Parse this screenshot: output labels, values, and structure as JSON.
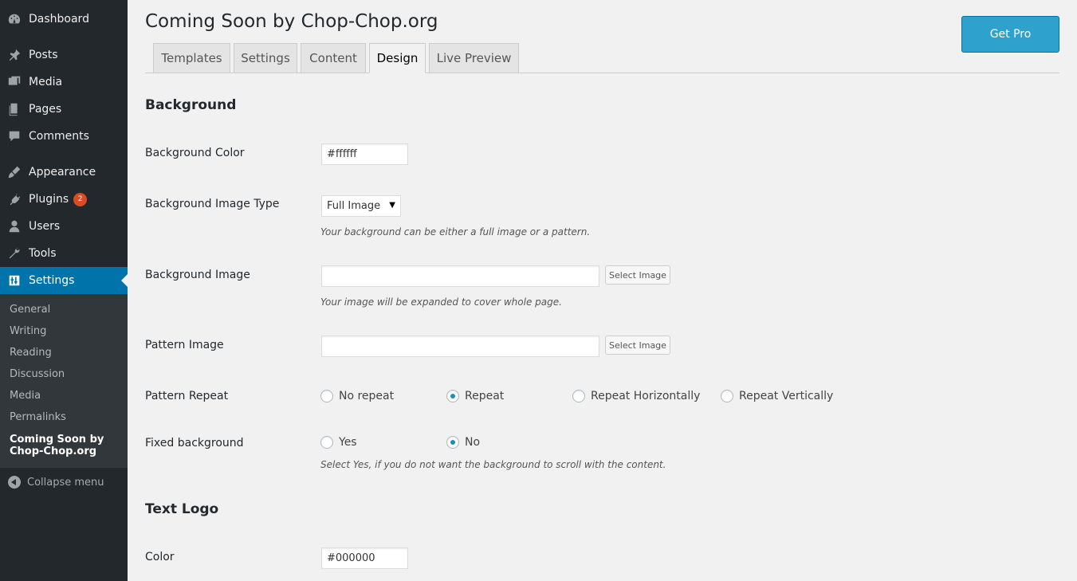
{
  "sidebar": {
    "items": [
      {
        "label": "Dashboard",
        "icon": "dashboard-icon"
      },
      {
        "label": "Posts",
        "icon": "pin-icon"
      },
      {
        "label": "Media",
        "icon": "media-icon"
      },
      {
        "label": "Pages",
        "icon": "pages-icon"
      },
      {
        "label": "Comments",
        "icon": "comment-icon"
      },
      {
        "label": "Appearance",
        "icon": "brush-icon"
      },
      {
        "label": "Plugins",
        "icon": "plug-icon",
        "badge": "2"
      },
      {
        "label": "Users",
        "icon": "user-icon"
      },
      {
        "label": "Tools",
        "icon": "wrench-icon"
      },
      {
        "label": "Settings",
        "icon": "settings-icon",
        "active": true
      }
    ],
    "submenu": [
      "General",
      "Writing",
      "Reading",
      "Discussion",
      "Media",
      "Permalinks",
      "Coming Soon by Chop-Chop.org"
    ],
    "collapse_label": "Collapse menu"
  },
  "header": {
    "title": "Coming Soon by Chop-Chop.org",
    "get_pro_label": "Get Pro"
  },
  "tabs": [
    "Templates",
    "Settings",
    "Content",
    "Design",
    "Live Preview"
  ],
  "active_tab": "Design",
  "background_section": {
    "title": "Background",
    "bg_color_label": "Background Color",
    "bg_color_value": "#ffffff",
    "bg_type_label": "Background Image Type",
    "bg_type_value": "Full Image",
    "bg_type_desc": "Your background can be either a full image or a pattern.",
    "bg_image_label": "Background Image",
    "bg_image_value": "",
    "select_image_label": "Select Image",
    "bg_image_desc": "Your image will be expanded to cover whole page.",
    "pattern_image_label": "Pattern Image",
    "pattern_image_value": "",
    "pattern_repeat_label": "Pattern Repeat",
    "pattern_repeat_options": [
      "No repeat",
      "Repeat",
      "Repeat Horizontally",
      "Repeat Vertically"
    ],
    "pattern_repeat_selected": "Repeat",
    "fixed_bg_label": "Fixed background",
    "fixed_bg_options": [
      "Yes",
      "No"
    ],
    "fixed_bg_selected": "No",
    "fixed_bg_desc": "Select Yes, if you do not want the background to scroll with the content."
  },
  "text_logo_section": {
    "title": "Text Logo",
    "color_label": "Color",
    "color_value": "#000000"
  },
  "colors": {
    "sidebar_bg": "#23282d",
    "submenu_bg": "#32373c",
    "accent": "#0073aa",
    "get_pro_bg": "#2ea2cc",
    "badge": "#d54e21"
  }
}
